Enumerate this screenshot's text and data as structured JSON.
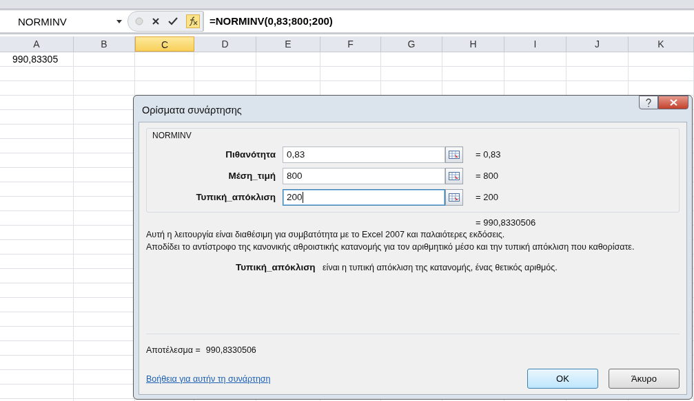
{
  "name_box": "NORMINV",
  "formula": "=NORMINV(0,83;800;200)",
  "columns": [
    {
      "label": "A",
      "selected": false
    },
    {
      "label": "B",
      "selected": false
    },
    {
      "label": "C",
      "selected": true
    },
    {
      "label": "D",
      "selected": false
    },
    {
      "label": "E",
      "selected": false
    },
    {
      "label": "F",
      "selected": false
    },
    {
      "label": "G",
      "selected": false
    },
    {
      "label": "H",
      "selected": false
    },
    {
      "label": "I",
      "selected": false
    },
    {
      "label": "J",
      "selected": false
    },
    {
      "label": "K",
      "selected": false
    }
  ],
  "rows": [
    [
      "990,83305"
    ]
  ],
  "dialog": {
    "title": "Ορίσματα συνάρτησης",
    "function": "NORMINV",
    "arguments": [
      {
        "label": "Πιθανότητα",
        "value": "0,83",
        "result": "= 0,83",
        "focused": false
      },
      {
        "label": "Μέση_τιμή",
        "value": "800",
        "result": "= 800",
        "focused": false
      },
      {
        "label": "Τυπική_απόκλιση",
        "value": "200",
        "result": "= 200",
        "focused": true
      }
    ],
    "formula_result": "= 990,8330506",
    "description": [
      "Αυτή η λειτουργία είναι διαθέσιμη για συμβατότητα με το Excel 2007 και παλαιότερες εκδόσεις.",
      "Αποδίδει το αντίστροφο της κανονικής αθροιστικής κατανομής για τον αριθμητικό μέσο και την τυπική απόκλιση που καθορίσατε."
    ],
    "argument_help": "**Τυπική_απόκλιση**   είναι η τυπική απόκλιση της κατανομής, ένας θετικός αριθμός.",
    "result_label": "Αποτέλεσμα =",
    "result_value": "990,8330506",
    "help_link": "Βοήθεια για αυτήν τη συνάρτηση",
    "buttons": [
      {
        "label": "OK",
        "kind": "default"
      },
      {
        "label": "Άκυρο",
        "kind": "normal"
      }
    ]
  }
}
